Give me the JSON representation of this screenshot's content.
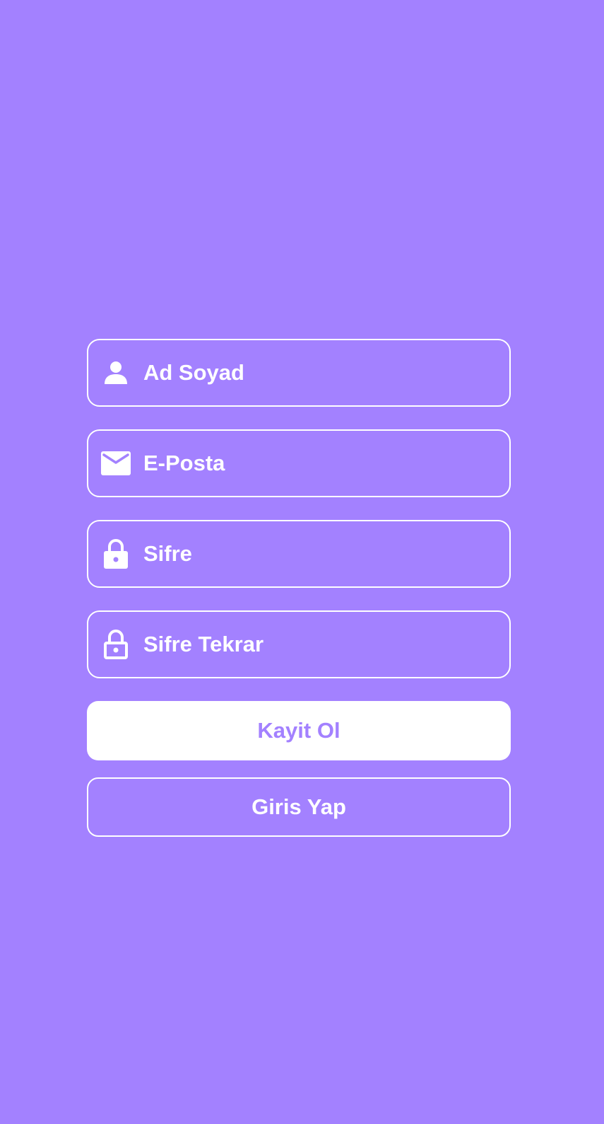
{
  "theme": {
    "background": "#a381ff",
    "foreground": "#ffffff"
  },
  "form": {
    "fields": [
      {
        "icon": "person-icon",
        "placeholder": "Ad Soyad",
        "value": ""
      },
      {
        "icon": "mail-icon",
        "placeholder": "E-Posta",
        "value": ""
      },
      {
        "icon": "lock-filled-icon",
        "placeholder": "Sifre",
        "value": ""
      },
      {
        "icon": "lock-outline-icon",
        "placeholder": "Sifre Tekrar",
        "value": ""
      }
    ],
    "register_label": "Kayit Ol",
    "login_label": "Giris Yap"
  }
}
